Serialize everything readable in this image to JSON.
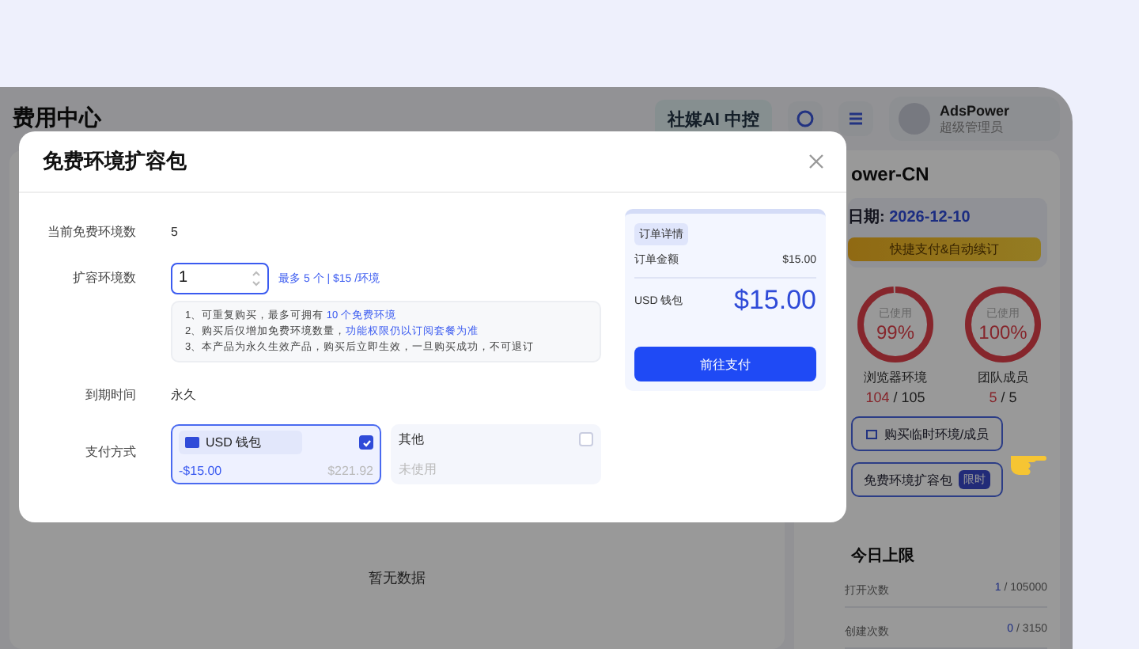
{
  "app": {
    "title": "费用中心",
    "ai_button": "社媒AI 中控",
    "user": {
      "name": "AdsPower",
      "role": "超级管理员"
    }
  },
  "main": {
    "empty_text": "暂无数据"
  },
  "side_panel": {
    "plan_name": "ower-CN",
    "expiry_label": "日期:",
    "expiry_date": "2026-12-10",
    "renew_banner": "快捷支付&自动续订",
    "usage": [
      {
        "caption": "已使用",
        "percent": "99%",
        "level": 0.99,
        "label": "浏览器环境",
        "used": "104",
        "sep": "/",
        "total": "105"
      },
      {
        "caption": "已使用",
        "percent": "100%",
        "level": 1,
        "label": "团队成员",
        "used": "5",
        "sep": "/",
        "total": "5"
      }
    ],
    "buttons": [
      {
        "kind": "icon",
        "label": "购买临时环境/成员"
      },
      {
        "kind": "badge",
        "label": "免费环境扩容包",
        "badge": "限时"
      }
    ],
    "daily_limits": {
      "title": "今日上限",
      "rows": [
        {
          "label": "打开次数",
          "used": "1",
          "sep": "/",
          "total": "105000"
        },
        {
          "label": "创建次数",
          "used": "0",
          "sep": "/",
          "total": "3150"
        }
      ]
    }
  },
  "dialog": {
    "title": "免费环境扩容包",
    "current": {
      "label": "当前免费环境数",
      "value": "5"
    },
    "quantity": {
      "label": "扩容环境数",
      "value": "1",
      "hint": "最多 5 个 | $15 /环境"
    },
    "notes": [
      [
        {
          "text": "1、可重复购买，最多可拥有 ",
          "highlight": false
        },
        {
          "text": "10 个免费环境",
          "highlight": true
        }
      ],
      [
        {
          "text": "2、购买后仅增加免费环境数量，",
          "highlight": false
        },
        {
          "text": "功能权限仍以订阅套餐为准",
          "highlight": true
        }
      ],
      [
        {
          "text": "3、本产品为永久生效产品，购买后立即生效，一旦购买成功，不可退订",
          "highlight": false
        }
      ]
    ],
    "expiry": {
      "label": "到期时间",
      "value": "永久"
    },
    "payment": {
      "label": "支付方式",
      "options": [
        {
          "kind": "wallet",
          "name": "USD 钱包",
          "amount": "-$15.00",
          "balance": "$221.92",
          "selected": true
        },
        {
          "kind": "other",
          "name": "其他",
          "status": "未使用",
          "selected": false
        }
      ]
    },
    "order": {
      "tag": "订单详情",
      "total_label": "订单金额",
      "total": "$15.00",
      "pay_label": "USD 钱包",
      "pay_amount": "$15.00",
      "button": "前往支付"
    }
  }
}
